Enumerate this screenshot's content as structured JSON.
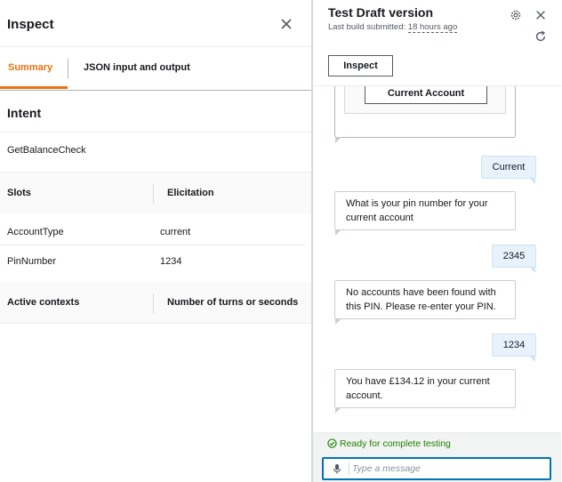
{
  "inspect": {
    "title": "Inspect",
    "tabs": [
      {
        "label": "Summary"
      },
      {
        "label": "JSON input and output"
      }
    ],
    "intent_heading": "Intent",
    "intent_value": "GetBalanceCheck",
    "slots_columns": [
      "Slots",
      "Elicitation"
    ],
    "slots": [
      {
        "name": "AccountType",
        "value": "current"
      },
      {
        "name": "PinNumber",
        "value": "1234"
      }
    ],
    "contexts_columns": [
      "Active contexts",
      "Number of turns or seconds"
    ]
  },
  "test": {
    "title": "Test Draft version",
    "subtitle_prefix": "Last build submitted: ",
    "subtitle_time": "18 hours ago",
    "inspect_button": "Inspect",
    "card_button": "Current Account",
    "messages": [
      {
        "from": "user",
        "text": "Current"
      },
      {
        "from": "bot",
        "text": "What is your pin number for your current account"
      },
      {
        "from": "user",
        "text": "2345"
      },
      {
        "from": "bot",
        "text": "No accounts have been found with this PIN. Please re-enter your PIN."
      },
      {
        "from": "user",
        "text": "1234"
      },
      {
        "from": "bot",
        "text": "You have £134.12 in your current account."
      }
    ],
    "status": "Ready for complete testing",
    "input_placeholder": "Type a message"
  },
  "colors": {
    "accent": "#ec7211",
    "success": "#1d8102",
    "focus": "#0073bb",
    "user_bubble": "#e7f2fb"
  },
  "icons": [
    "close-icon",
    "gear-icon",
    "refresh-icon",
    "check-circle-icon",
    "microphone-icon"
  ]
}
